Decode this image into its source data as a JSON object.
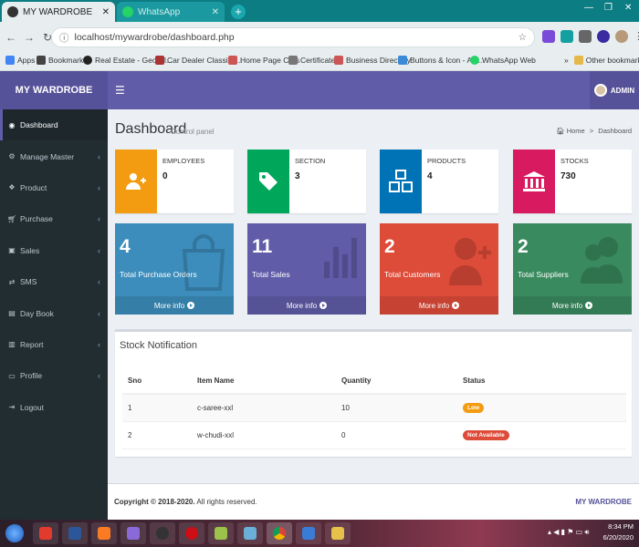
{
  "browser": {
    "tabs": [
      {
        "title": "MY WARDROBE",
        "active": true
      },
      {
        "title": "WhatsApp",
        "active": false
      }
    ],
    "url": "localhost/mywardrobe/dashboard.php",
    "bookmarks": [
      "Apps",
      "Bookmarks",
      "Real Estate - Geo Cl...",
      "Car Dealer Classifie...",
      "Home Page Cars",
      "Certificates",
      "Business Directory",
      "Buttons & Icon - Ac...",
      "WhatsApp Web",
      "Other bookmarks"
    ]
  },
  "app": {
    "logo": "MY WARDROBE",
    "user": "ADMIN",
    "accent": "#605ca8"
  },
  "sidebar": {
    "items": [
      {
        "label": "Dashboard",
        "icon": "dashboard-icon",
        "active": true,
        "chevron": false
      },
      {
        "label": "Manage Master",
        "icon": "cogs-icon",
        "active": false,
        "chevron": true
      },
      {
        "label": "Product",
        "icon": "cubes-icon",
        "active": false,
        "chevron": true
      },
      {
        "label": "Purchase",
        "icon": "cart-icon",
        "active": false,
        "chevron": true
      },
      {
        "label": "Sales",
        "icon": "bag-icon",
        "active": false,
        "chevron": true
      },
      {
        "label": "SMS",
        "icon": "exchange-icon",
        "active": false,
        "chevron": true
      },
      {
        "label": "Day Book",
        "icon": "book-icon",
        "active": false,
        "chevron": true
      },
      {
        "label": "Report",
        "icon": "chart-icon",
        "active": false,
        "chevron": true
      },
      {
        "label": "Profile",
        "icon": "file-icon",
        "active": false,
        "chevron": true
      },
      {
        "label": "Logout",
        "icon": "logout-icon",
        "active": false,
        "chevron": false
      }
    ]
  },
  "page": {
    "title": "Dashboard",
    "subtitle": "Control panel",
    "breadcrumb": [
      "Home",
      "Dashboard"
    ]
  },
  "info_boxes": [
    {
      "label": "EMPLOYEES",
      "value": "0",
      "color": "#f39c12",
      "icon": "add-user-icon"
    },
    {
      "label": "SECTION",
      "value": "3",
      "color": "#00a65a",
      "icon": "tag-icon"
    },
    {
      "label": "PRODUCTS",
      "value": "4",
      "color": "#0073b7",
      "icon": "cubes-icon"
    },
    {
      "label": "STOCKS",
      "value": "730",
      "color": "#d81b60",
      "icon": "bank-icon"
    }
  ],
  "small_boxes": [
    {
      "value": "4",
      "label": "Total Purchase Orders",
      "more": "More info",
      "color": "#3c8dbc",
      "icon": "bag-icon"
    },
    {
      "value": "11",
      "label": "Total Sales",
      "more": "More info",
      "color": "#605ca8",
      "icon": "bar-chart-icon"
    },
    {
      "value": "2",
      "label": "Total Customers",
      "more": "More info",
      "color": "#dd4b39",
      "icon": "user-plus-icon"
    },
    {
      "value": "2",
      "label": "Total Suppliers",
      "more": "More info",
      "color": "#398a5e",
      "icon": "users-icon"
    }
  ],
  "stock_panel": {
    "title": "Stock Notification",
    "columns": [
      "Sno",
      "Item Name",
      "Quantity",
      "Status"
    ],
    "rows": [
      {
        "sno": "1",
        "item": "c-saree-xxl",
        "qty": "10",
        "status": "Low",
        "status_color": "#f39c12"
      },
      {
        "sno": "2",
        "item": "w-chudi-xxl",
        "qty": "0",
        "status": "Not Available",
        "status_color": "#dd4b39"
      }
    ]
  },
  "footer": {
    "copyright_bold": "Copyright © 2018-2020.",
    "copyright_rest": " All rights reserved.",
    "brand": "MY WARDROBE"
  },
  "taskbar": {
    "time": "8:34 PM",
    "date": "6/20/2020"
  }
}
